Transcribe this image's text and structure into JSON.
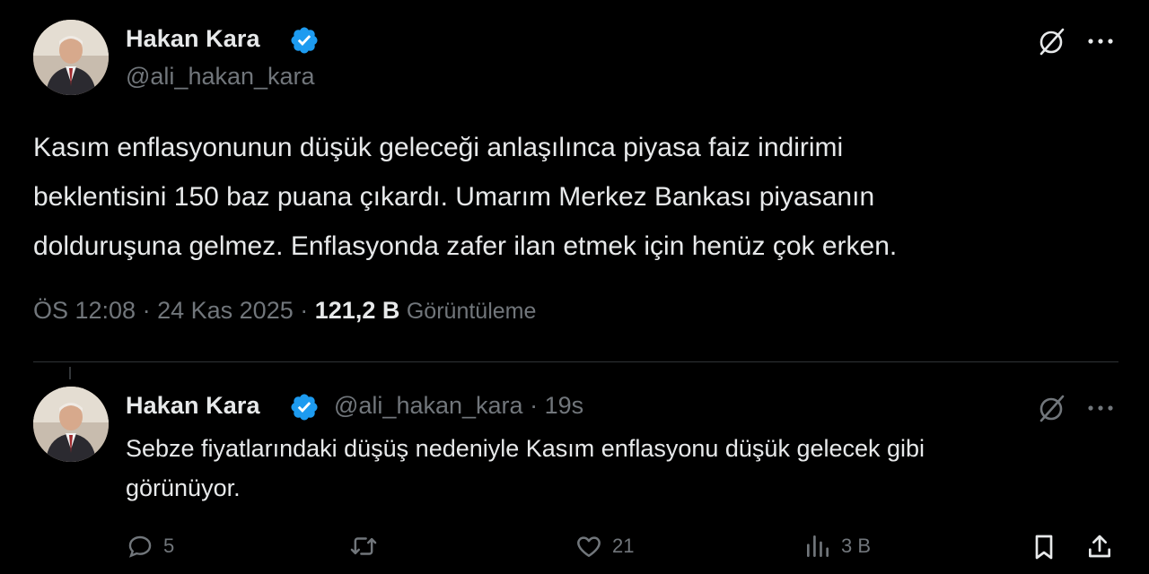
{
  "colors": {
    "background": "#000000",
    "primary_text": "#e7e9ea",
    "secondary_text": "#71767b",
    "verified": "#1d9bf0",
    "divider": "#2f3336"
  },
  "main_tweet": {
    "author_name": "Hakan Kara",
    "author_handle": "@ali_hakan_kara",
    "verified_icon": "verified-badge-icon",
    "text_lines": [
      "Kasım enflasyonunun düşük geleceği anlaşılınca piyasa faiz indirimi",
      "beklentisini 150 baz puana çıkardı. Umarım Merkez Bankası piyasanın",
      "dolduruşuna gelmez. Enflasyonda zafer ilan etmek için henüz çok erken."
    ],
    "time": "ÖS 12:08",
    "separator": "·",
    "date": "24 Kas 2025",
    "views_count": "121,2 B",
    "views_label": "Görüntüleme",
    "grok_icon": "grok-slash-circle-icon",
    "more_icon": "more-dots-icon"
  },
  "reply_tweet": {
    "author_name": "Hakan Kara",
    "author_handle": "@ali_hakan_kara",
    "separator": "·",
    "time_ago": "19s",
    "text_lines": [
      "Sebze fiyatlarındaki düşüş nedeniyle Kasım enflasyonu düşük gelecek gibi",
      "görünüyor."
    ],
    "actions": {
      "replies": "5",
      "retweets": "",
      "likes": "21",
      "views": "3 B"
    }
  }
}
